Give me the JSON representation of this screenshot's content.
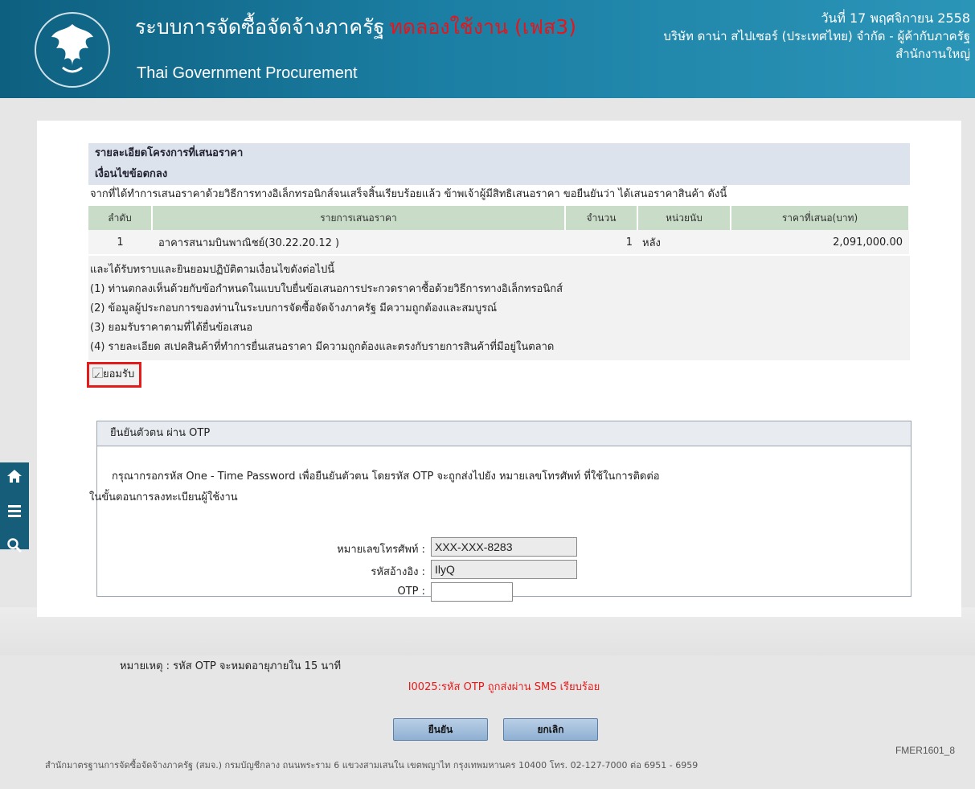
{
  "header": {
    "title": "ระบบการจัดซื้อจัดจ้างภาครัฐ",
    "trial_label": "ทดลองใช้งาน (เฟส3)",
    "subtitle": "Thai Government Procurement",
    "date": "วันที่ 17 พฤศจิกายน 2558",
    "company": "บริษัท ดาน่า สไปเซอร์ (ประเทศไทย) จำกัด - ผู้ค้ากับภาครัฐ",
    "branch": "สำนักงานใหญ่",
    "logo_icon": "garuda-emblem-icon"
  },
  "sidebar": {
    "items": [
      {
        "icon": "home-icon"
      },
      {
        "icon": "menu-icon"
      },
      {
        "icon": "search-icon"
      }
    ]
  },
  "project": {
    "section_title": "รายละเอียดโครงการที่เสนอราคา",
    "conditions_title": "เงื่อนไขข้อตกลง",
    "intro": "จากที่ได้ทำการเสนอราคาด้วยวิธีการทางอิเล็กทรอนิกส์จนเสร็จสิ้นเรียบร้อยแล้ว ข้าพเจ้าผู้มีสิทธิเสนอราคา ขอยืนยันว่า ได้เสนอราคาสินค้า ดังนี้",
    "table": {
      "headers": [
        "ลำดับ",
        "รายการเสนอราคา",
        "จำนวน",
        "หน่วยนับ",
        "ราคาที่เสนอ(บาท)"
      ],
      "rows": [
        {
          "no": "1",
          "item": "อาคารสนามบินพาณิชย์(30.22.20.12 )",
          "qty": "1",
          "unit": "หลัง",
          "price": "2,091,000.00"
        }
      ]
    },
    "terms_intro": "และได้รับทราบและยินยอมปฏิบัติตามเงื่อนไขดังต่อไปนี้",
    "terms": [
      "(1) ท่านตกลงเห็นด้วยกับข้อกำหนดในแบบใบยื่นข้อเสนอการประกวดราคาซื้อด้วยวิธีการทางอิเล็กทรอนิกส์",
      "(2) ข้อมูลผู้ประกอบการของท่านในระบบการจัดซื้อจัดจ้างภาครัฐ มีความถูกต้องและสมบูรณ์",
      "(3) ยอมรับราคาตามที่ได้ยื่นข้อเสนอ",
      "(4) รายละเอียด สเปคสินค้าที่ทำการยื่นเสนอราคา มีความถูกต้องและตรงกับรายการสินค้าที่มีอยู่ในตลาด"
    ],
    "accept_label": "ยอมรับ",
    "accept_checked": true
  },
  "otp": {
    "title": "ยืนยันตัวตน ผ่าน OTP",
    "desc_line1": "กรุณากรอกรหัส One - Time Password เพื่อยืนยันตัวตน โดยรหัส OTP จะถูกส่งไปยัง หมายเลขโทรศัพท์ ที่ใช้ในการติดต่อ",
    "desc_line2": "ในขั้นตอนการลงทะเบียนผู้ใช้งาน",
    "phone_label": "หมายเลขโทรศัพท์ :",
    "phone_value": "XXX-XXX-8283",
    "ref_label": "รหัสอ้างอิง :",
    "ref_value": "IlyQ",
    "otp_label": "OTP :",
    "otp_value": "",
    "note": "หมายเหตุ : รหัส OTP จะหมดอายุภายใน 15 นาที",
    "message": "I0025:รหัส OTP ถูกส่งผ่าน SMS เรียบร้อย",
    "message_color": "#e51a1a",
    "confirm_label": "ยืนยัน",
    "cancel_label": "ยกเลิก"
  },
  "footer": {
    "address": "สำนักมาตรฐานการจัดซื้อจัดจ้างภาครัฐ (สมจ.) กรมบัญชีกลาง ถนนพระราม 6 แขวงสามเสนใน เขตพญาไท กรุงเทพมหานคร 10400 โทร. 02-127-7000 ต่อ 6951 - 6959",
    "form_code": "FMER1601_8"
  }
}
